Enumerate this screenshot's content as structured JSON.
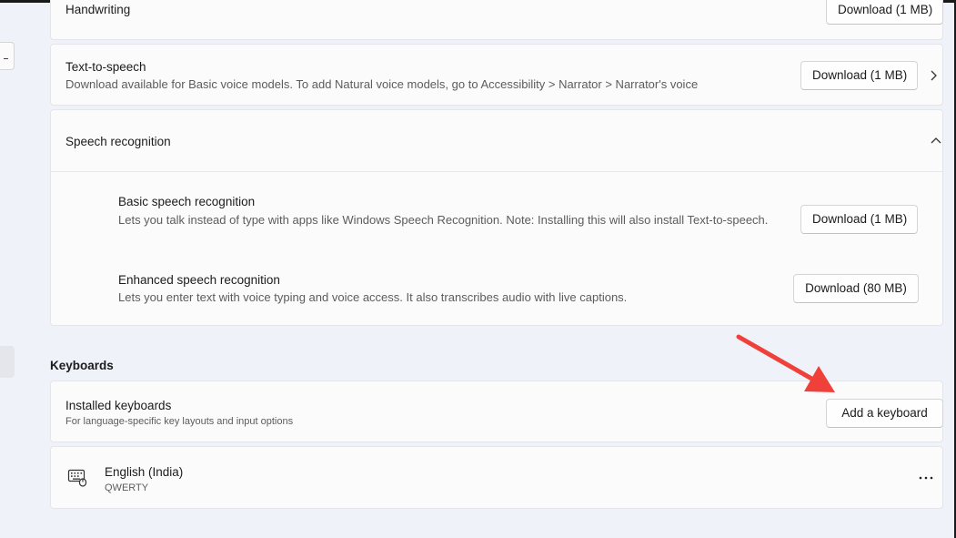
{
  "handwriting": {
    "title": "Handwriting",
    "button": "Download (1 MB)"
  },
  "tts": {
    "title": "Text-to-speech",
    "description": "Download available for Basic voice models. To add Natural voice models, go to Accessibility > Narrator > Narrator's voice",
    "button": "Download (1 MB)"
  },
  "speech_recognition": {
    "title": "Speech recognition",
    "items": [
      {
        "title": "Basic speech recognition",
        "description": "Lets you talk instead of type with apps like Windows Speech Recognition. Note: Installing this will also install Text-to-speech.",
        "button": "Download (1 MB)"
      },
      {
        "title": "Enhanced speech recognition",
        "description": "Lets you enter text with voice typing and voice access. It also transcribes audio with live captions.",
        "button": "Download (80 MB)"
      }
    ]
  },
  "keyboards": {
    "section_title": "Keyboards",
    "installed_title": "Installed keyboards",
    "installed_description": "For language-specific key layouts and input options",
    "add_button": "Add a keyboard",
    "keyboard_item": {
      "name": "English (India)",
      "layout": "QWERTY"
    }
  },
  "icons": {
    "chevron_right": "chevron-right-icon",
    "chevron_up": "chevron-up-icon",
    "keyboard": "keyboard-icon",
    "more": "more-options-icon"
  },
  "colors": {
    "annotation_arrow": "#f0403a",
    "background": "#eff2f8",
    "card": "#fbfbfc"
  }
}
